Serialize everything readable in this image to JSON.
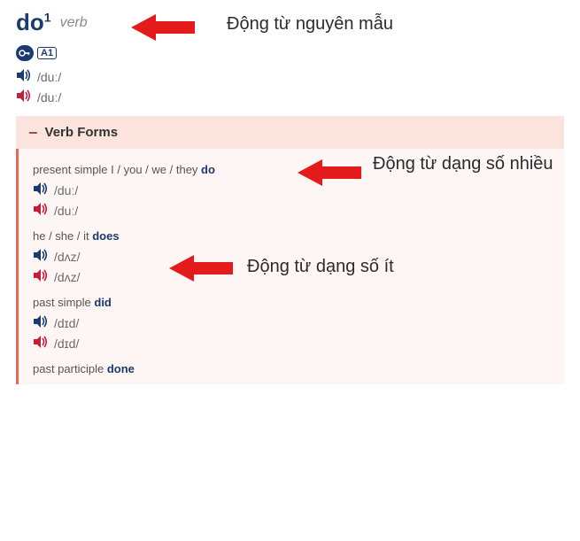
{
  "head": {
    "word": "do",
    "homograph": "1",
    "pos": "verb",
    "key": "⚿",
    "level": "A1"
  },
  "top_pron": [
    {
      "ipa": "/duː/",
      "accent": "uk"
    },
    {
      "ipa": "/duː/",
      "accent": "us"
    }
  ],
  "panel": {
    "title": "Verb Forms",
    "collapse": "−"
  },
  "forms": [
    {
      "label_pre": "present simple I / you / we / they ",
      "word": "do",
      "pron": [
        {
          "ipa": "/duː/",
          "accent": "uk"
        },
        {
          "ipa": "/duː/",
          "accent": "us"
        }
      ]
    },
    {
      "label_pre": "he / she / it ",
      "word": "does",
      "pron": [
        {
          "ipa": "/dʌz/",
          "accent": "uk"
        },
        {
          "ipa": "/dʌz/",
          "accent": "us"
        }
      ]
    },
    {
      "label_pre": "past simple ",
      "word": "did",
      "pron": [
        {
          "ipa": "/dɪd/",
          "accent": "uk"
        },
        {
          "ipa": "/dɪd/",
          "accent": "us"
        }
      ]
    },
    {
      "label_pre": "past participle ",
      "word": "done",
      "pron": []
    }
  ],
  "captions": {
    "c1": "Động từ nguyên mẫu",
    "c2": "Động từ dạng số nhiều",
    "c3": "Động từ dạng số ít"
  },
  "colors": {
    "arrow": "#e31b1b",
    "speaker_uk": "#1b3a6f",
    "speaker_us": "#c41e3a"
  }
}
